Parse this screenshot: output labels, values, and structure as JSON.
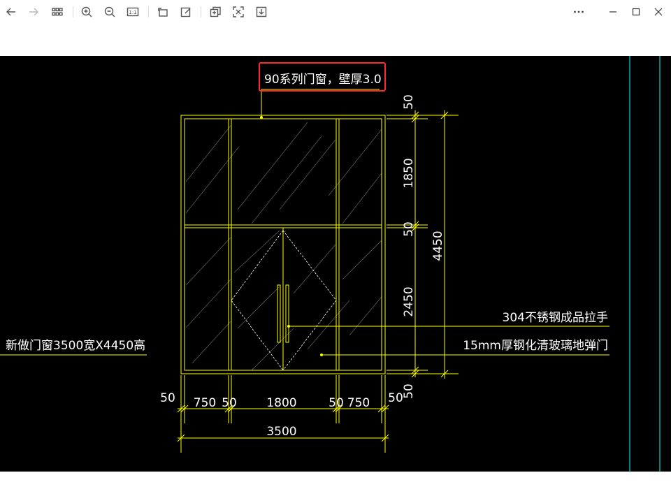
{
  "toolbar": {
    "left_icons": [
      "back-icon",
      "forward-icon",
      "grid-view-icon",
      "zoom-in-icon",
      "zoom-out-icon",
      "actual-size-icon",
      "rotate-icon",
      "edit-icon",
      "copy-to-image-icon",
      "scan-icon",
      "download-icon"
    ],
    "actual_size_label": "1:1",
    "right_icons": [
      "more-icon",
      "minimize-icon",
      "maximize-icon",
      "close-icon"
    ]
  },
  "drawing": {
    "title_annotation": "90系列门窗，壁厚3.0",
    "left_note": "新做门窗3500宽X4450高",
    "right_notes": [
      "304不锈钢成品拉手",
      "15mm厚钢化清玻璃地弹门"
    ],
    "vertical_dims": [
      "50",
      "1850",
      "50",
      "2450",
      "50"
    ],
    "total_height": "4450",
    "horizontal_dims": [
      "50",
      "750",
      "50",
      "1800",
      "50",
      "750",
      "50"
    ],
    "total_width": "3500",
    "colors": {
      "frame": "#ffff00",
      "text": "#ffffff",
      "guide": "#00ffff",
      "highlight": "#ff2a2a",
      "background": "#000000"
    }
  }
}
